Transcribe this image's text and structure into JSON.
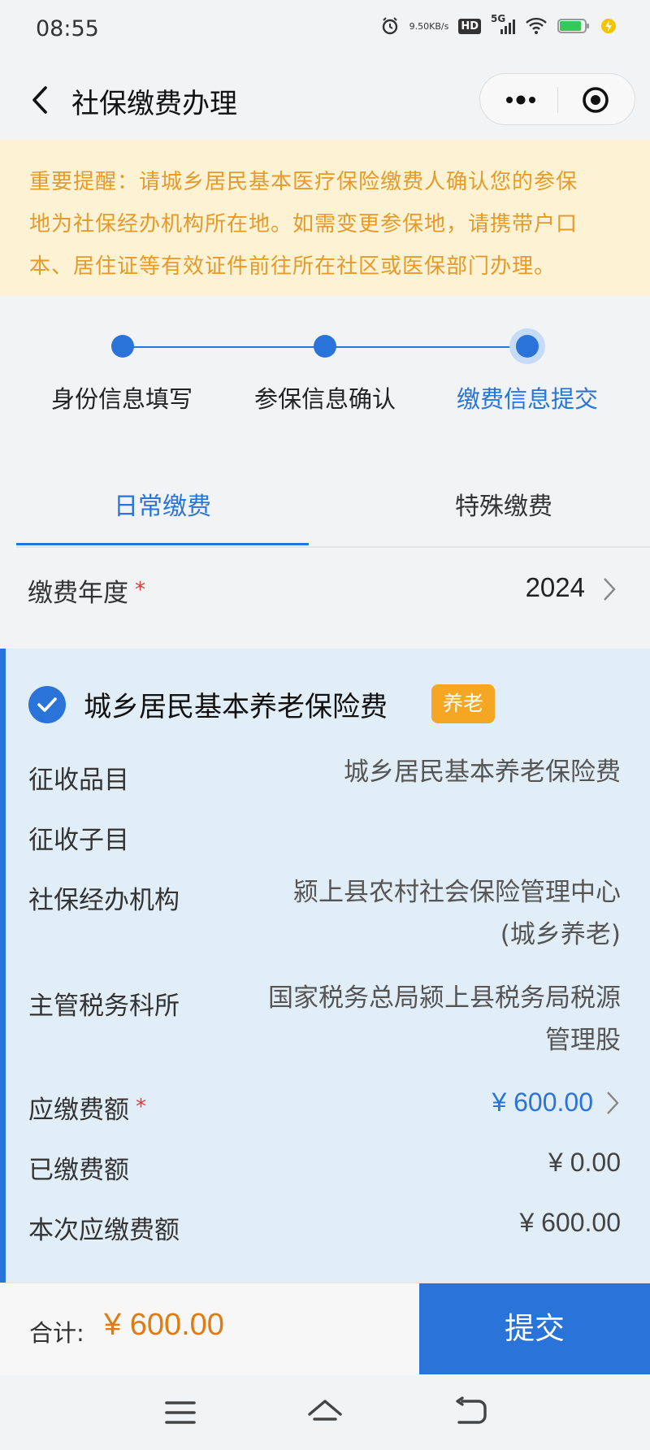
{
  "status_bar": {
    "time": "08:55",
    "net_speed_value": "9.50",
    "net_speed_unit": "KB/s",
    "hd_label": "HD",
    "network_label": "5G"
  },
  "nav": {
    "title": "社保缴费办理"
  },
  "notice": {
    "lines": [
      "重要提醒：请城乡居民基本医疗保险缴费人确认您的参保",
      "地为社保经办机构所在地。如需变更参保地，请携带户口",
      "本、居住证等有效证件前往所在社区或医保部门办理。"
    ]
  },
  "steps": [
    {
      "label": "身份信息填写",
      "active": false
    },
    {
      "label": "参保信息确认",
      "active": false
    },
    {
      "label": "缴费信息提交",
      "active": true
    }
  ],
  "tabs": [
    {
      "label": "日常缴费",
      "active": true
    },
    {
      "label": "特殊缴费",
      "active": false
    }
  ],
  "year_row": {
    "label": "缴费年度",
    "required_mark": "*",
    "value": "2024"
  },
  "card": {
    "checked": true,
    "title": "城乡居民基本养老保险费",
    "badge": "养老",
    "rows": [
      {
        "label": "征收品目",
        "value": "城乡居民基本养老保险费"
      },
      {
        "label": "征收子目",
        "value": ""
      },
      {
        "label": "社保经办机构",
        "value_line1": "颍上县农村社会保险管理中心",
        "value_line2": "(城乡养老)"
      },
      {
        "label": "主管税务科所",
        "value_line1": "国家税务总局颍上县税务局税源",
        "value_line2": "管理股"
      },
      {
        "label": "应缴费额",
        "required_mark": "*",
        "value": "¥ 600.00"
      },
      {
        "label": "已缴费额",
        "value": "¥ 0.00"
      },
      {
        "label": "本次应缴费额",
        "value": "¥ 600.00"
      }
    ]
  },
  "bottom_bar": {
    "total_label": "合计:",
    "total_value": "¥ 600.00",
    "submit_label": "提交"
  },
  "colors": {
    "primary": "#2a74d9",
    "notice_bg": "#fdf2d3",
    "notice_text": "#e59a2a",
    "badge": "#f5a623",
    "total": "#e07b12",
    "card_bg": "#e2eef7"
  }
}
